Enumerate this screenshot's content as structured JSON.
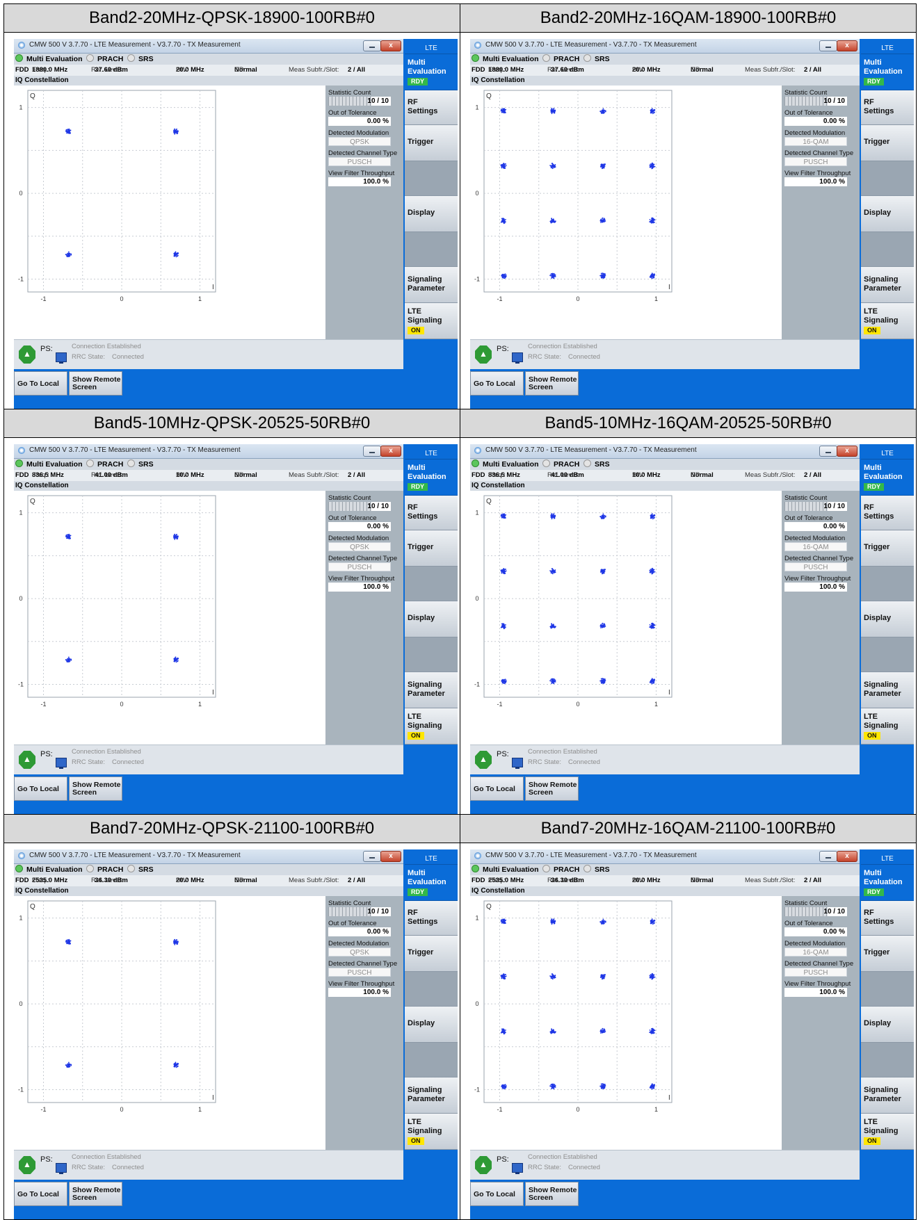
{
  "window": {
    "title": "CMW 500 V 3.7.70 - LTE Measurement  - V3.7.70 - TX Measurement",
    "close_glyph": "x",
    "tabs": [
      "Multi Evaluation",
      "PRACH",
      "SRS"
    ],
    "sub_title": "IQ Constellation",
    "info": {
      "duplex": "FDD",
      "freq_label": "Freq.:",
      "ref_label": "Ref. Level:",
      "bw_label": "BW:",
      "cp_label": "CP :",
      "cp_value": "Normal",
      "subfr_label": "Meas Subfr./Slot:",
      "subfr_value": "2  / All"
    },
    "readouts": {
      "statistic_count_label": "Statistic Count",
      "statistic_count": "10 / 10",
      "out_of_tolerance_label": "Out of Tolerance",
      "out_of_tolerance": "0.00  %",
      "detected_modulation_label": "Detected Modulation",
      "detected_channel_type_label": "Detected Channel Type",
      "detected_channel_type": "PUSCH",
      "view_filter_label": "View Filter Throughput",
      "view_filter": "100.0  %"
    },
    "axes": {
      "q": "Q",
      "i": "I",
      "y_ticks": [
        "1",
        "0",
        "-1"
      ],
      "x_ticks": [
        "-1",
        "0",
        "1"
      ]
    },
    "status": {
      "ps_label": "PS:",
      "connection": "Connection Established",
      "rrc_label": "RRC State:",
      "rrc_value": "Connected"
    },
    "buttons": {
      "go_local": "Go To Local",
      "remote_line1": "Show Remote",
      "remote_line2": "Screen"
    },
    "side": {
      "lte": "LTE",
      "multi1": "Multi",
      "multi2": "Evaluation",
      "rdy": "RDY",
      "rf1": "RF",
      "rf2": "Settings",
      "trigger": "Trigger",
      "display": "Display",
      "sig1": "Signaling",
      "sig2": "Parameter",
      "ltesig1": "LTE",
      "ltesig2": "Signaling",
      "on": "ON"
    },
    "colors": {
      "accent_blue": "#0a6cd8",
      "constellation": "#1f37e6",
      "rdy": "#33b84a",
      "on": "#ffe600"
    }
  },
  "panels": [
    {
      "caption": "Band2-20MHz-QPSK-18900-100RB#0",
      "freq": "1880.0 MHz",
      "ref_level": "37.60 dBm",
      "bw": "20.0 MHz",
      "modulation": "QPSK",
      "chart_data": {
        "type": "scatter",
        "xlim": [
          -1.2,
          1.2
        ],
        "ylim": [
          -1.15,
          1.2
        ],
        "points": [
          {
            "x": -0.68,
            "y": 0.72
          },
          {
            "x": 0.69,
            "y": 0.72
          },
          {
            "x": -0.68,
            "y": -0.71
          },
          {
            "x": 0.69,
            "y": -0.71
          }
        ]
      }
    },
    {
      "caption": "Band2-20MHz-16QAM-18900-100RB#0",
      "freq": "1880.0 MHz",
      "ref_level": "37.60 dBm",
      "bw": "20.0 MHz",
      "modulation": "16-QAM",
      "chart_data": {
        "type": "scatter",
        "xlim": [
          -1.2,
          1.2
        ],
        "ylim": [
          -1.15,
          1.2
        ],
        "points": [
          {
            "x": -0.95,
            "y": 0.96
          },
          {
            "x": -0.32,
            "y": 0.96
          },
          {
            "x": 0.32,
            "y": 0.96
          },
          {
            "x": 0.95,
            "y": 0.96
          },
          {
            "x": -0.95,
            "y": 0.32
          },
          {
            "x": -0.32,
            "y": 0.32
          },
          {
            "x": 0.32,
            "y": 0.32
          },
          {
            "x": 0.95,
            "y": 0.32
          },
          {
            "x": -0.95,
            "y": -0.32
          },
          {
            "x": -0.32,
            "y": -0.32
          },
          {
            "x": 0.32,
            "y": -0.32
          },
          {
            "x": 0.95,
            "y": -0.32
          },
          {
            "x": -0.95,
            "y": -0.96
          },
          {
            "x": -0.32,
            "y": -0.96
          },
          {
            "x": 0.32,
            "y": -0.96
          },
          {
            "x": 0.95,
            "y": -0.96
          }
        ]
      }
    },
    {
      "caption": "Band5-10MHz-QPSK-20525-50RB#0",
      "freq": "836.5 MHz",
      "ref_level": "41.00 dBm",
      "bw": "10.0 MHz",
      "modulation": "QPSK",
      "chart_data": {
        "type": "scatter",
        "xlim": [
          -1.2,
          1.2
        ],
        "ylim": [
          -1.15,
          1.2
        ],
        "points": [
          {
            "x": -0.68,
            "y": 0.72
          },
          {
            "x": 0.69,
            "y": 0.72
          },
          {
            "x": -0.68,
            "y": -0.71
          },
          {
            "x": 0.69,
            "y": -0.71
          }
        ]
      }
    },
    {
      "caption": "Band5-10MHz-16QAM-20525-50RB#0",
      "freq": "836.5 MHz",
      "ref_level": "41.00 dBm",
      "bw": "10.0 MHz",
      "modulation": "16-QAM",
      "chart_data": {
        "type": "scatter",
        "xlim": [
          -1.2,
          1.2
        ],
        "ylim": [
          -1.15,
          1.2
        ],
        "points": [
          {
            "x": -0.95,
            "y": 0.96
          },
          {
            "x": -0.32,
            "y": 0.96
          },
          {
            "x": 0.32,
            "y": 0.96
          },
          {
            "x": 0.95,
            "y": 0.96
          },
          {
            "x": -0.95,
            "y": 0.32
          },
          {
            "x": -0.32,
            "y": 0.32
          },
          {
            "x": 0.32,
            "y": 0.32
          },
          {
            "x": 0.95,
            "y": 0.32
          },
          {
            "x": -0.95,
            "y": -0.32
          },
          {
            "x": -0.32,
            "y": -0.32
          },
          {
            "x": 0.32,
            "y": -0.32
          },
          {
            "x": 0.95,
            "y": -0.32
          },
          {
            "x": -0.95,
            "y": -0.96
          },
          {
            "x": -0.32,
            "y": -0.96
          },
          {
            "x": 0.32,
            "y": -0.96
          },
          {
            "x": 0.95,
            "y": -0.96
          }
        ]
      }
    },
    {
      "caption": "Band7-20MHz-QPSK-21100-100RB#0",
      "freq": "2535.0 MHz",
      "ref_level": "36.30 dBm",
      "bw": "20.0 MHz",
      "modulation": "QPSK",
      "chart_data": {
        "type": "scatter",
        "xlim": [
          -1.2,
          1.2
        ],
        "ylim": [
          -1.15,
          1.2
        ],
        "points": [
          {
            "x": -0.68,
            "y": 0.72
          },
          {
            "x": 0.69,
            "y": 0.72
          },
          {
            "x": -0.68,
            "y": -0.71
          },
          {
            "x": 0.69,
            "y": -0.71
          }
        ]
      }
    },
    {
      "caption": "Band7-20MHz-16QAM-21100-100RB#0",
      "freq": "2535.0 MHz",
      "ref_level": "36.30 dBm",
      "bw": "20.0 MHz",
      "modulation": "16-QAM",
      "chart_data": {
        "type": "scatter",
        "xlim": [
          -1.2,
          1.2
        ],
        "ylim": [
          -1.15,
          1.2
        ],
        "points": [
          {
            "x": -0.95,
            "y": 0.96
          },
          {
            "x": -0.32,
            "y": 0.96
          },
          {
            "x": 0.32,
            "y": 0.96
          },
          {
            "x": 0.95,
            "y": 0.96
          },
          {
            "x": -0.95,
            "y": 0.32
          },
          {
            "x": -0.32,
            "y": 0.32
          },
          {
            "x": 0.32,
            "y": 0.32
          },
          {
            "x": 0.95,
            "y": 0.32
          },
          {
            "x": -0.95,
            "y": -0.32
          },
          {
            "x": -0.32,
            "y": -0.32
          },
          {
            "x": 0.32,
            "y": -0.32
          },
          {
            "x": 0.95,
            "y": -0.32
          },
          {
            "x": -0.95,
            "y": -0.96
          },
          {
            "x": -0.32,
            "y": -0.96
          },
          {
            "x": 0.32,
            "y": -0.96
          },
          {
            "x": 0.95,
            "y": -0.96
          }
        ]
      }
    }
  ]
}
